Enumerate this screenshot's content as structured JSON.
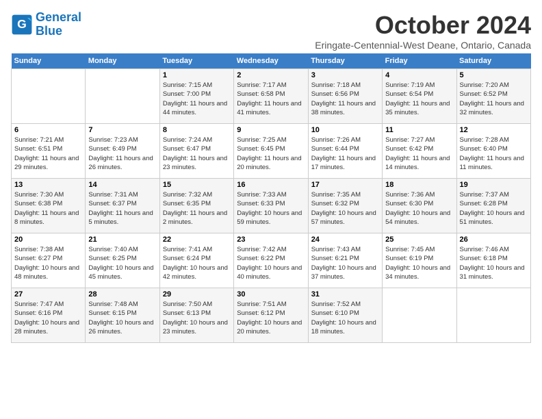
{
  "logo": {
    "line1": "General",
    "line2": "Blue"
  },
  "title": "October 2024",
  "location": "Eringate-Centennial-West Deane, Ontario, Canada",
  "days_of_week": [
    "Sunday",
    "Monday",
    "Tuesday",
    "Wednesday",
    "Thursday",
    "Friday",
    "Saturday"
  ],
  "weeks": [
    [
      {
        "day": "",
        "content": ""
      },
      {
        "day": "",
        "content": ""
      },
      {
        "day": "1",
        "content": "Sunrise: 7:15 AM\nSunset: 7:00 PM\nDaylight: 11 hours and 44 minutes."
      },
      {
        "day": "2",
        "content": "Sunrise: 7:17 AM\nSunset: 6:58 PM\nDaylight: 11 hours and 41 minutes."
      },
      {
        "day": "3",
        "content": "Sunrise: 7:18 AM\nSunset: 6:56 PM\nDaylight: 11 hours and 38 minutes."
      },
      {
        "day": "4",
        "content": "Sunrise: 7:19 AM\nSunset: 6:54 PM\nDaylight: 11 hours and 35 minutes."
      },
      {
        "day": "5",
        "content": "Sunrise: 7:20 AM\nSunset: 6:52 PM\nDaylight: 11 hours and 32 minutes."
      }
    ],
    [
      {
        "day": "6",
        "content": "Sunrise: 7:21 AM\nSunset: 6:51 PM\nDaylight: 11 hours and 29 minutes."
      },
      {
        "day": "7",
        "content": "Sunrise: 7:23 AM\nSunset: 6:49 PM\nDaylight: 11 hours and 26 minutes."
      },
      {
        "day": "8",
        "content": "Sunrise: 7:24 AM\nSunset: 6:47 PM\nDaylight: 11 hours and 23 minutes."
      },
      {
        "day": "9",
        "content": "Sunrise: 7:25 AM\nSunset: 6:45 PM\nDaylight: 11 hours and 20 minutes."
      },
      {
        "day": "10",
        "content": "Sunrise: 7:26 AM\nSunset: 6:44 PM\nDaylight: 11 hours and 17 minutes."
      },
      {
        "day": "11",
        "content": "Sunrise: 7:27 AM\nSunset: 6:42 PM\nDaylight: 11 hours and 14 minutes."
      },
      {
        "day": "12",
        "content": "Sunrise: 7:28 AM\nSunset: 6:40 PM\nDaylight: 11 hours and 11 minutes."
      }
    ],
    [
      {
        "day": "13",
        "content": "Sunrise: 7:30 AM\nSunset: 6:38 PM\nDaylight: 11 hours and 8 minutes."
      },
      {
        "day": "14",
        "content": "Sunrise: 7:31 AM\nSunset: 6:37 PM\nDaylight: 11 hours and 5 minutes."
      },
      {
        "day": "15",
        "content": "Sunrise: 7:32 AM\nSunset: 6:35 PM\nDaylight: 11 hours and 2 minutes."
      },
      {
        "day": "16",
        "content": "Sunrise: 7:33 AM\nSunset: 6:33 PM\nDaylight: 10 hours and 59 minutes."
      },
      {
        "day": "17",
        "content": "Sunrise: 7:35 AM\nSunset: 6:32 PM\nDaylight: 10 hours and 57 minutes."
      },
      {
        "day": "18",
        "content": "Sunrise: 7:36 AM\nSunset: 6:30 PM\nDaylight: 10 hours and 54 minutes."
      },
      {
        "day": "19",
        "content": "Sunrise: 7:37 AM\nSunset: 6:28 PM\nDaylight: 10 hours and 51 minutes."
      }
    ],
    [
      {
        "day": "20",
        "content": "Sunrise: 7:38 AM\nSunset: 6:27 PM\nDaylight: 10 hours and 48 minutes."
      },
      {
        "day": "21",
        "content": "Sunrise: 7:40 AM\nSunset: 6:25 PM\nDaylight: 10 hours and 45 minutes."
      },
      {
        "day": "22",
        "content": "Sunrise: 7:41 AM\nSunset: 6:24 PM\nDaylight: 10 hours and 42 minutes."
      },
      {
        "day": "23",
        "content": "Sunrise: 7:42 AM\nSunset: 6:22 PM\nDaylight: 10 hours and 40 minutes."
      },
      {
        "day": "24",
        "content": "Sunrise: 7:43 AM\nSunset: 6:21 PM\nDaylight: 10 hours and 37 minutes."
      },
      {
        "day": "25",
        "content": "Sunrise: 7:45 AM\nSunset: 6:19 PM\nDaylight: 10 hours and 34 minutes."
      },
      {
        "day": "26",
        "content": "Sunrise: 7:46 AM\nSunset: 6:18 PM\nDaylight: 10 hours and 31 minutes."
      }
    ],
    [
      {
        "day": "27",
        "content": "Sunrise: 7:47 AM\nSunset: 6:16 PM\nDaylight: 10 hours and 28 minutes."
      },
      {
        "day": "28",
        "content": "Sunrise: 7:48 AM\nSunset: 6:15 PM\nDaylight: 10 hours and 26 minutes."
      },
      {
        "day": "29",
        "content": "Sunrise: 7:50 AM\nSunset: 6:13 PM\nDaylight: 10 hours and 23 minutes."
      },
      {
        "day": "30",
        "content": "Sunrise: 7:51 AM\nSunset: 6:12 PM\nDaylight: 10 hours and 20 minutes."
      },
      {
        "day": "31",
        "content": "Sunrise: 7:52 AM\nSunset: 6:10 PM\nDaylight: 10 hours and 18 minutes."
      },
      {
        "day": "",
        "content": ""
      },
      {
        "day": "",
        "content": ""
      }
    ]
  ]
}
